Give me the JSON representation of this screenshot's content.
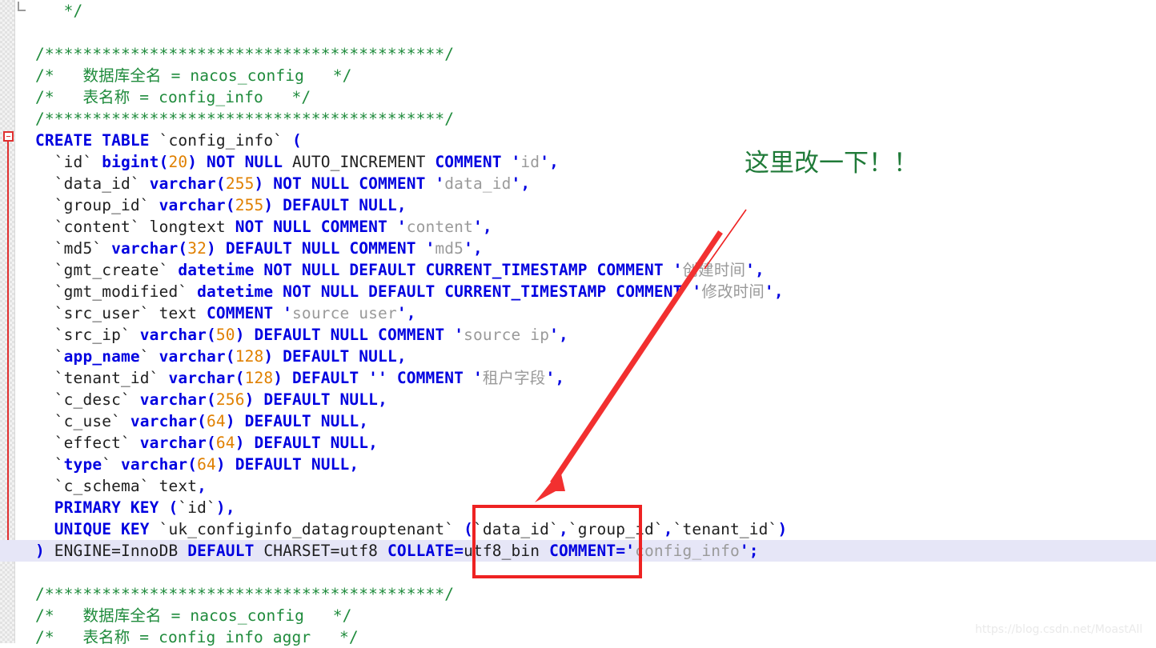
{
  "editor": {
    "language": "sql",
    "highlighted_line_index": 24,
    "colors": {
      "keyword": "#0000e0",
      "number": "#e08000",
      "string": "#9a9a9a",
      "comment": "#1f8b3c",
      "plain": "#202020",
      "current_line_background": "#e6e6f7",
      "gutter_background": "#f2f2f2",
      "fold_marker": "#e03030"
    },
    "lines": [
      {
        "indent": 1,
        "tokens": [
          {
            "t": " ",
            "c": "plain"
          },
          {
            "t": "*/",
            "c": "cmt"
          }
        ]
      },
      {
        "indent": 0,
        "tokens": []
      },
      {
        "indent": 0,
        "tokens": [
          {
            "t": "/******************************************/",
            "c": "cmt"
          }
        ]
      },
      {
        "indent": 0,
        "tokens": [
          {
            "t": "/*   数据库全名 = nacos_config   */",
            "c": "cmt"
          }
        ]
      },
      {
        "indent": 0,
        "tokens": [
          {
            "t": "/*   表名称 = config_info   */",
            "c": "cmt"
          }
        ]
      },
      {
        "indent": 0,
        "tokens": [
          {
            "t": "/******************************************/",
            "c": "cmt"
          }
        ]
      },
      {
        "indent": 0,
        "tokens": [
          {
            "t": "CREATE TABLE",
            "c": "kw"
          },
          {
            "t": " `config_info` ",
            "c": "plain"
          },
          {
            "t": "(",
            "c": "punct"
          }
        ]
      },
      {
        "indent": 1,
        "tokens": [
          {
            "t": "`id` ",
            "c": "plain"
          },
          {
            "t": "bigint",
            "c": "kw"
          },
          {
            "t": "(",
            "c": "punct"
          },
          {
            "t": "20",
            "c": "num"
          },
          {
            "t": ")",
            "c": "punct"
          },
          {
            "t": " ",
            "c": "plain"
          },
          {
            "t": "NOT NULL",
            "c": "kw"
          },
          {
            "t": " AUTO_INCREMENT ",
            "c": "plain"
          },
          {
            "t": "COMMENT",
            "c": "kw"
          },
          {
            "t": " ",
            "c": "plain"
          },
          {
            "t": "'",
            "c": "punct"
          },
          {
            "t": "id",
            "c": "str"
          },
          {
            "t": "'",
            "c": "punct"
          },
          {
            "t": ",",
            "c": "punct"
          }
        ]
      },
      {
        "indent": 1,
        "tokens": [
          {
            "t": "`data_id` ",
            "c": "plain"
          },
          {
            "t": "varchar",
            "c": "kw"
          },
          {
            "t": "(",
            "c": "punct"
          },
          {
            "t": "255",
            "c": "num"
          },
          {
            "t": ")",
            "c": "punct"
          },
          {
            "t": " ",
            "c": "plain"
          },
          {
            "t": "NOT NULL COMMENT",
            "c": "kw"
          },
          {
            "t": " ",
            "c": "plain"
          },
          {
            "t": "'",
            "c": "punct"
          },
          {
            "t": "data_id",
            "c": "str"
          },
          {
            "t": "'",
            "c": "punct"
          },
          {
            "t": ",",
            "c": "punct"
          }
        ]
      },
      {
        "indent": 1,
        "tokens": [
          {
            "t": "`group_id` ",
            "c": "plain"
          },
          {
            "t": "varchar",
            "c": "kw"
          },
          {
            "t": "(",
            "c": "punct"
          },
          {
            "t": "255",
            "c": "num"
          },
          {
            "t": ")",
            "c": "punct"
          },
          {
            "t": " ",
            "c": "plain"
          },
          {
            "t": "DEFAULT NULL",
            "c": "kw"
          },
          {
            "t": ",",
            "c": "punct"
          }
        ]
      },
      {
        "indent": 1,
        "tokens": [
          {
            "t": "`content` longtext ",
            "c": "plain"
          },
          {
            "t": "NOT NULL COMMENT",
            "c": "kw"
          },
          {
            "t": " ",
            "c": "plain"
          },
          {
            "t": "'",
            "c": "punct"
          },
          {
            "t": "content",
            "c": "str"
          },
          {
            "t": "'",
            "c": "punct"
          },
          {
            "t": ",",
            "c": "punct"
          }
        ]
      },
      {
        "indent": 1,
        "tokens": [
          {
            "t": "`md5` ",
            "c": "plain"
          },
          {
            "t": "varchar",
            "c": "kw"
          },
          {
            "t": "(",
            "c": "punct"
          },
          {
            "t": "32",
            "c": "num"
          },
          {
            "t": ")",
            "c": "punct"
          },
          {
            "t": " ",
            "c": "plain"
          },
          {
            "t": "DEFAULT NULL COMMENT",
            "c": "kw"
          },
          {
            "t": " ",
            "c": "plain"
          },
          {
            "t": "'",
            "c": "punct"
          },
          {
            "t": "md5",
            "c": "str"
          },
          {
            "t": "'",
            "c": "punct"
          },
          {
            "t": ",",
            "c": "punct"
          }
        ]
      },
      {
        "indent": 1,
        "tokens": [
          {
            "t": "`gmt_create` ",
            "c": "plain"
          },
          {
            "t": "datetime NOT NULL DEFAULT CURRENT_TIMESTAMP COMMENT",
            "c": "kw"
          },
          {
            "t": " ",
            "c": "plain"
          },
          {
            "t": "'",
            "c": "punct"
          },
          {
            "t": "创建时间",
            "c": "str"
          },
          {
            "t": "'",
            "c": "punct"
          },
          {
            "t": ",",
            "c": "punct"
          }
        ]
      },
      {
        "indent": 1,
        "tokens": [
          {
            "t": "`gmt_modified` ",
            "c": "plain"
          },
          {
            "t": "datetime NOT NULL DEFAULT CURRENT_TIMESTAMP COMMENT",
            "c": "kw"
          },
          {
            "t": " ",
            "c": "plain"
          },
          {
            "t": "'",
            "c": "punct"
          },
          {
            "t": "修改时间",
            "c": "str"
          },
          {
            "t": "'",
            "c": "punct"
          },
          {
            "t": ",",
            "c": "punct"
          }
        ]
      },
      {
        "indent": 1,
        "tokens": [
          {
            "t": "`src_user` text ",
            "c": "plain"
          },
          {
            "t": "COMMENT",
            "c": "kw"
          },
          {
            "t": " ",
            "c": "plain"
          },
          {
            "t": "'",
            "c": "punct"
          },
          {
            "t": "source user",
            "c": "str"
          },
          {
            "t": "'",
            "c": "punct"
          },
          {
            "t": ",",
            "c": "punct"
          }
        ]
      },
      {
        "indent": 1,
        "tokens": [
          {
            "t": "`src_ip` ",
            "c": "plain"
          },
          {
            "t": "varchar",
            "c": "kw"
          },
          {
            "t": "(",
            "c": "punct"
          },
          {
            "t": "50",
            "c": "num"
          },
          {
            "t": ")",
            "c": "punct"
          },
          {
            "t": " ",
            "c": "plain"
          },
          {
            "t": "DEFAULT NULL COMMENT",
            "c": "kw"
          },
          {
            "t": " ",
            "c": "plain"
          },
          {
            "t": "'",
            "c": "punct"
          },
          {
            "t": "source ip",
            "c": "str"
          },
          {
            "t": "'",
            "c": "punct"
          },
          {
            "t": ",",
            "c": "punct"
          }
        ]
      },
      {
        "indent": 1,
        "tokens": [
          {
            "t": "`",
            "c": "plain"
          },
          {
            "t": "app_name",
            "c": "kw"
          },
          {
            "t": "` ",
            "c": "plain"
          },
          {
            "t": "varchar",
            "c": "kw"
          },
          {
            "t": "(",
            "c": "punct"
          },
          {
            "t": "128",
            "c": "num"
          },
          {
            "t": ")",
            "c": "punct"
          },
          {
            "t": " ",
            "c": "plain"
          },
          {
            "t": "DEFAULT NULL",
            "c": "kw"
          },
          {
            "t": ",",
            "c": "punct"
          }
        ]
      },
      {
        "indent": 1,
        "tokens": [
          {
            "t": "`tenant_id` ",
            "c": "plain"
          },
          {
            "t": "varchar",
            "c": "kw"
          },
          {
            "t": "(",
            "c": "punct"
          },
          {
            "t": "128",
            "c": "num"
          },
          {
            "t": ")",
            "c": "punct"
          },
          {
            "t": " ",
            "c": "plain"
          },
          {
            "t": "DEFAULT",
            "c": "kw"
          },
          {
            "t": " ",
            "c": "plain"
          },
          {
            "t": "''",
            "c": "punct"
          },
          {
            "t": " ",
            "c": "plain"
          },
          {
            "t": "COMMENT",
            "c": "kw"
          },
          {
            "t": " ",
            "c": "plain"
          },
          {
            "t": "'",
            "c": "punct"
          },
          {
            "t": "租户字段",
            "c": "str"
          },
          {
            "t": "'",
            "c": "punct"
          },
          {
            "t": ",",
            "c": "punct"
          }
        ]
      },
      {
        "indent": 1,
        "tokens": [
          {
            "t": "`c_desc` ",
            "c": "plain"
          },
          {
            "t": "varchar",
            "c": "kw"
          },
          {
            "t": "(",
            "c": "punct"
          },
          {
            "t": "256",
            "c": "num"
          },
          {
            "t": ")",
            "c": "punct"
          },
          {
            "t": " ",
            "c": "plain"
          },
          {
            "t": "DEFAULT NULL",
            "c": "kw"
          },
          {
            "t": ",",
            "c": "punct"
          }
        ]
      },
      {
        "indent": 1,
        "tokens": [
          {
            "t": "`c_use` ",
            "c": "plain"
          },
          {
            "t": "varchar",
            "c": "kw"
          },
          {
            "t": "(",
            "c": "punct"
          },
          {
            "t": "64",
            "c": "num"
          },
          {
            "t": ")",
            "c": "punct"
          },
          {
            "t": " ",
            "c": "plain"
          },
          {
            "t": "DEFAULT NULL",
            "c": "kw"
          },
          {
            "t": ",",
            "c": "punct"
          }
        ]
      },
      {
        "indent": 1,
        "tokens": [
          {
            "t": "`effect` ",
            "c": "plain"
          },
          {
            "t": "varchar",
            "c": "kw"
          },
          {
            "t": "(",
            "c": "punct"
          },
          {
            "t": "64",
            "c": "num"
          },
          {
            "t": ")",
            "c": "punct"
          },
          {
            "t": " ",
            "c": "plain"
          },
          {
            "t": "DEFAULT NULL",
            "c": "kw"
          },
          {
            "t": ",",
            "c": "punct"
          }
        ]
      },
      {
        "indent": 1,
        "tokens": [
          {
            "t": "`",
            "c": "plain"
          },
          {
            "t": "type",
            "c": "kw"
          },
          {
            "t": "` ",
            "c": "plain"
          },
          {
            "t": "varchar",
            "c": "kw"
          },
          {
            "t": "(",
            "c": "punct"
          },
          {
            "t": "64",
            "c": "num"
          },
          {
            "t": ")",
            "c": "punct"
          },
          {
            "t": " ",
            "c": "plain"
          },
          {
            "t": "DEFAULT NULL",
            "c": "kw"
          },
          {
            "t": ",",
            "c": "punct"
          }
        ]
      },
      {
        "indent": 1,
        "tokens": [
          {
            "t": "`c_schema` text",
            "c": "plain"
          },
          {
            "t": ",",
            "c": "punct"
          }
        ]
      },
      {
        "indent": 1,
        "tokens": [
          {
            "t": "PRIMARY KEY",
            "c": "kw"
          },
          {
            "t": " ",
            "c": "plain"
          },
          {
            "t": "(",
            "c": "punct"
          },
          {
            "t": "`id`",
            "c": "plain"
          },
          {
            "t": ")",
            "c": "punct"
          },
          {
            "t": ",",
            "c": "punct"
          }
        ]
      },
      {
        "indent": 1,
        "tokens": [
          {
            "t": "UNIQUE KEY",
            "c": "kw"
          },
          {
            "t": " `uk_configinfo_datagrouptenant` ",
            "c": "plain"
          },
          {
            "t": "(",
            "c": "punct"
          },
          {
            "t": "`data_id`",
            "c": "plain"
          },
          {
            "t": ",",
            "c": "punct"
          },
          {
            "t": "`group_id`",
            "c": "plain"
          },
          {
            "t": ",",
            "c": "punct"
          },
          {
            "t": "`tenant_id`",
            "c": "plain"
          },
          {
            "t": ")",
            "c": "punct"
          }
        ]
      },
      {
        "indent": 0,
        "highlight": true,
        "tokens": [
          {
            "t": ")",
            "c": "punct"
          },
          {
            "t": " ENGINE=InnoDB ",
            "c": "plain"
          },
          {
            "t": "DEFAULT",
            "c": "kw"
          },
          {
            "t": " CHARSET=utf8 ",
            "c": "plain"
          },
          {
            "t": "COLLATE",
            "c": "kw"
          },
          {
            "t": "=",
            "c": "punct"
          },
          {
            "t": "utf8_bin ",
            "c": "plain"
          },
          {
            "t": "COMMENT",
            "c": "kw"
          },
          {
            "t": "=",
            "c": "punct"
          },
          {
            "t": "'",
            "c": "punct"
          },
          {
            "t": "config_info",
            "c": "str"
          },
          {
            "t": "'",
            "c": "punct"
          },
          {
            "t": ";",
            "c": "punct"
          }
        ]
      },
      {
        "indent": 0,
        "tokens": []
      },
      {
        "indent": 0,
        "tokens": [
          {
            "t": "/******************************************/",
            "c": "cmt"
          }
        ]
      },
      {
        "indent": 0,
        "tokens": [
          {
            "t": "/*   数据库全名 = nacos_config   */",
            "c": "cmt"
          }
        ]
      },
      {
        "indent": 0,
        "tokens": [
          {
            "t": "/*   表名称 = config info aggr   */",
            "c": "cmt"
          }
        ]
      }
    ]
  },
  "annotations": {
    "note_text": "这里改一下！！",
    "note_color": "#1f7a38",
    "arrow_color": "#ee2222",
    "rect_color": "#ee2222"
  },
  "watermark": {
    "text": "https://blog.csdn.net/MoastAll"
  }
}
